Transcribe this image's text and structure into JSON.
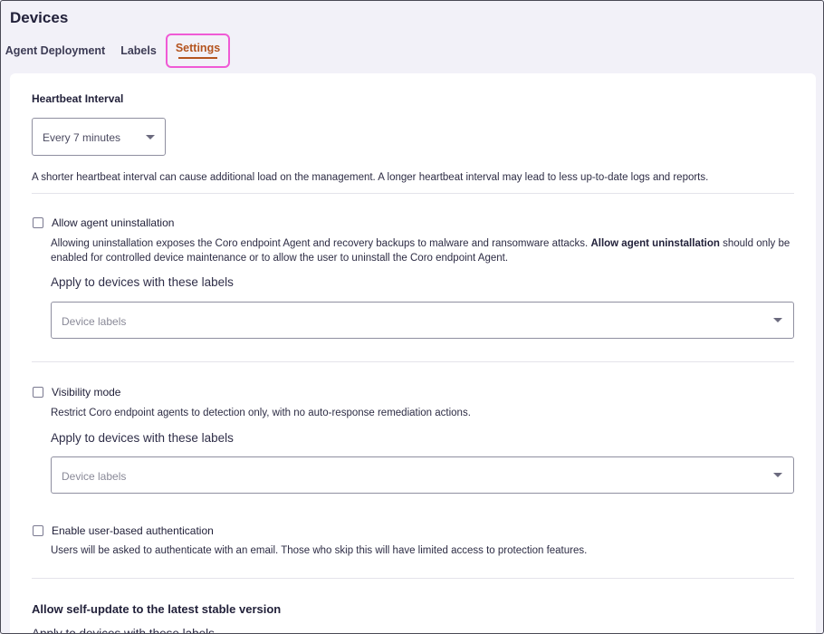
{
  "page": {
    "title": "Devices"
  },
  "tabs": [
    {
      "label": "Agent Deployment"
    },
    {
      "label": "Labels"
    },
    {
      "label": "Settings"
    }
  ],
  "active_tab": "Settings",
  "heartbeat": {
    "title": "Heartbeat Interval",
    "selected": "Every 7 minutes",
    "description": "A shorter heartbeat interval can cause additional load on the management. A longer heartbeat interval may lead to less up-to-date logs and reports."
  },
  "uninstall": {
    "label": "Allow agent uninstallation",
    "desc_part1": "Allowing uninstallation exposes the Coro endpoint Agent and recovery backups to malware and ransomware attacks. ",
    "desc_bold": "Allow agent uninstallation",
    "desc_part2": " should only be",
    "desc_line2": "enabled for controlled device maintenance or to allow the user to uninstall the Coro endpoint Agent.",
    "apply_label": "Apply to devices with these labels",
    "labels_placeholder": "Device labels"
  },
  "visibility": {
    "label": "Visibility mode",
    "description": "Restrict Coro endpoint agents to detection only, with no auto-response remediation actions.",
    "apply_label": "Apply to devices with these labels",
    "labels_placeholder": "Device labels"
  },
  "user_auth": {
    "label": "Enable user-based authentication",
    "description": "Users will be asked to authenticate with an email. Those who skip this will have limited access to protection features."
  },
  "self_update": {
    "title": "Allow self-update to the latest stable version",
    "apply_label": "Apply to devices with these labels"
  },
  "icons": {
    "dropdown": "caret-down-icon",
    "checkbox": "checkbox-unchecked-icon"
  },
  "colors": {
    "background": "#f2f1f8",
    "active_tab": "#b4541f",
    "highlight": "#f05ad5"
  }
}
